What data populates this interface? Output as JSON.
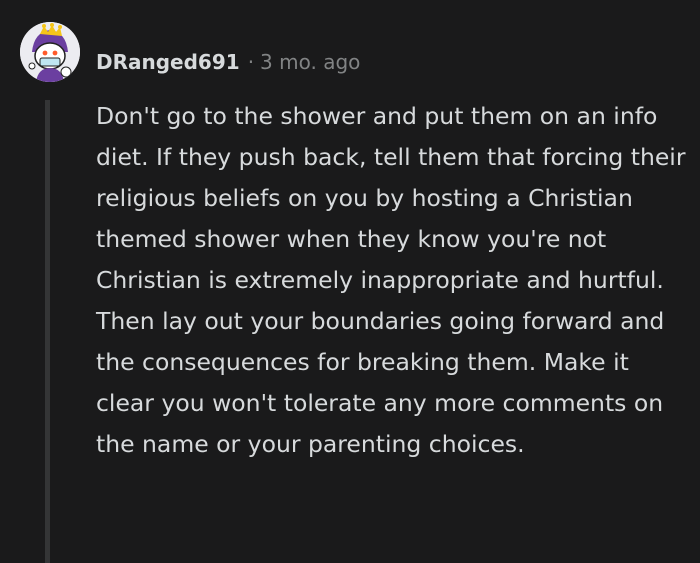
{
  "comment": {
    "avatar_icon": "snoo-avatar-icon",
    "username": "DRanged691",
    "separator": "·",
    "timestamp": "3 mo. ago",
    "body": "Don't go to the shower and put them on an info diet. If they push back, tell them that forcing their religious beliefs on you by hosting a Christian themed shower when they know you're not Christian is extremely inappropriate and hurtful. Then lay out your boundaries going forward and the consequences for breaking them. Make it clear you won't tolerate any more comments on the name or your parenting choices."
  },
  "colors": {
    "background": "#1a1a1b",
    "text": "#d7dadc",
    "meta": "#818384",
    "thread_line": "#343536",
    "avatar_hat": "#6b3fa0",
    "avatar_crown": "#f5c518"
  }
}
